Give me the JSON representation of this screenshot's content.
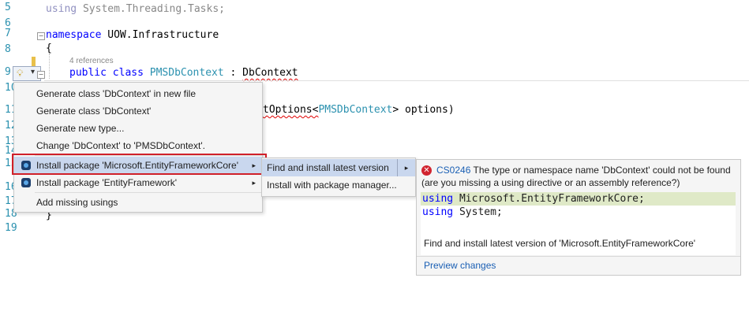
{
  "editor": {
    "lines": [
      {
        "num": "5",
        "using_kw": "using",
        "text": " System.Threading.Tasks;"
      },
      {
        "num": "6"
      },
      {
        "num": "7",
        "ns_kw": "namespace",
        "text": " UOW.Infrastructure"
      },
      {
        "num": "8",
        "text": "{"
      },
      {
        "num": "9",
        "codelens": "4 references",
        "kw1": "public",
        "kw2": "class",
        "class_name": "PMSDbContext",
        "sep": " : ",
        "base": "DbContext"
      },
      {
        "num": "10"
      },
      {
        "num": "11",
        "text_pre": "tOptions<",
        "type": "PMSDbContext",
        "text_post": "> options)"
      },
      {
        "num": "12"
      },
      {
        "num": "13"
      },
      {
        "num": "14"
      },
      {
        "num": "15"
      },
      {
        "num": "16"
      },
      {
        "num": "17"
      },
      {
        "num": "18",
        "text": "}"
      },
      {
        "num": "19"
      }
    ]
  },
  "lightbulb": {
    "icon": "lightbulb-icon",
    "dropdown": "▾"
  },
  "quick_actions": {
    "items": [
      {
        "label": "Generate class 'DbContext' in new file"
      },
      {
        "label": "Generate class 'DbContext'"
      },
      {
        "label": "Generate new type..."
      },
      {
        "label": "Change 'DbContext' to 'PMSDbContext'."
      },
      {
        "label": "Install package 'Microsoft.EntityFrameworkCore'",
        "submenu": "▸"
      },
      {
        "label": "Install package 'EntityFramework'",
        "submenu": "▸"
      },
      {
        "label": "Add missing usings"
      }
    ]
  },
  "install_submenu": {
    "items": [
      {
        "label": "Find and install latest version",
        "submenu": "▸"
      },
      {
        "label": "Install with package manager..."
      }
    ]
  },
  "preview": {
    "error_code": "CS0246",
    "error_msg": "The type or namespace name 'DbContext' could not be found",
    "error_msg2": "(are you missing a using directive or an assembly reference?)",
    "code1_kw": "using",
    "code1_rest": " Microsoft.EntityFrameworkCore;",
    "code2_kw": "using",
    "code2_rest": " System;",
    "description": "Find and install latest version of 'Microsoft.EntityFrameworkCore'",
    "preview_link": "Preview changes"
  },
  "colors": {
    "highlight": "#c9d7ee",
    "red_outline": "#d0202a",
    "added_line": "#dfe9c7"
  }
}
